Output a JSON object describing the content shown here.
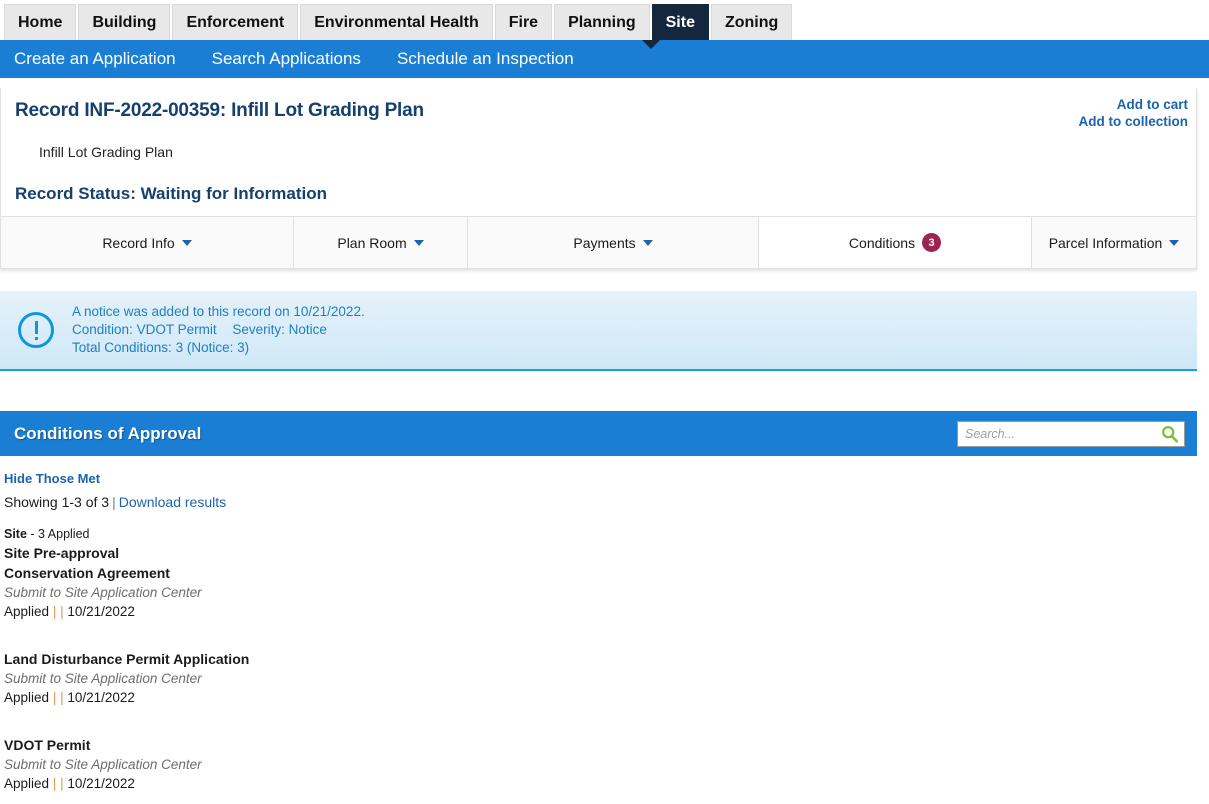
{
  "module_tabs": [
    {
      "label": "Home",
      "active": false
    },
    {
      "label": "Building",
      "active": false
    },
    {
      "label": "Enforcement",
      "active": false
    },
    {
      "label": "Environmental Health",
      "active": false
    },
    {
      "label": "Fire",
      "active": false
    },
    {
      "label": "Planning",
      "active": false
    },
    {
      "label": "Site",
      "active": true
    },
    {
      "label": "Zoning",
      "active": false
    }
  ],
  "subnav": {
    "items": [
      {
        "label": "Create an Application"
      },
      {
        "label": "Search Applications"
      },
      {
        "label": "Schedule an Inspection"
      }
    ]
  },
  "record": {
    "title": "Record INF-2022-00359: Infill Lot Grading Plan",
    "subtitle": "Infill Lot Grading Plan",
    "status": "Record Status: Waiting for Information",
    "links": [
      {
        "label": "Add to cart"
      },
      {
        "label": "Add to collection"
      }
    ],
    "tabs": [
      {
        "label": "Record Info",
        "caret": true,
        "badge": null,
        "active": false
      },
      {
        "label": "Plan Room",
        "caret": true,
        "badge": null,
        "active": false
      },
      {
        "label": "Payments",
        "caret": true,
        "badge": null,
        "active": false
      },
      {
        "label": "Conditions",
        "caret": false,
        "badge": "3",
        "active": true
      },
      {
        "label": "Parcel Information",
        "caret": true,
        "badge": null,
        "active": false
      }
    ]
  },
  "notice": {
    "icon": "exclamation-circle-icon",
    "line1": "A notice was added to this record on 10/21/2022.",
    "condition_label": "Condition:",
    "condition_value": "VDOT Permit",
    "severity_label": "Severity:",
    "severity_value": "Notice",
    "total_label": "Total Conditions:",
    "total_value": "3",
    "total_detail": "(Notice: 3)"
  },
  "conditions_section": {
    "title": "Conditions of Approval",
    "search": {
      "placeholder": "Search...",
      "value": "",
      "icon": "search-icon"
    },
    "hide_those_met": "Hide Those Met",
    "showing": "Showing 1-3 of 3",
    "showing_separator": "|",
    "download_results": "Download results",
    "group": {
      "name": "Site",
      "applied": "- 3 Applied",
      "subgroup": "Site Pre-approval"
    },
    "items": [
      {
        "name": "Conservation Agreement",
        "description": "Submit to Site Application Center",
        "status": "Applied",
        "date": "10/21/2022"
      },
      {
        "name": "Land Disturbance Permit Application",
        "description": "Submit to Site Application Center",
        "status": "Applied",
        "date": "10/21/2022"
      },
      {
        "name": "VDOT Permit",
        "description": "Submit to Site Application Center",
        "status": "Applied",
        "date": "10/21/2022"
      }
    ]
  },
  "colors": {
    "nav_blue": "#1a7fd4",
    "active_tab_navy": "#14273c",
    "badge_magenta": "#9c2452",
    "link_blue": "#1c63ae",
    "heading_navy": "#16406e",
    "notice_blue": "#1f7fc4",
    "search_green": "#7dc242",
    "pipe_orange": "#d89a55"
  }
}
